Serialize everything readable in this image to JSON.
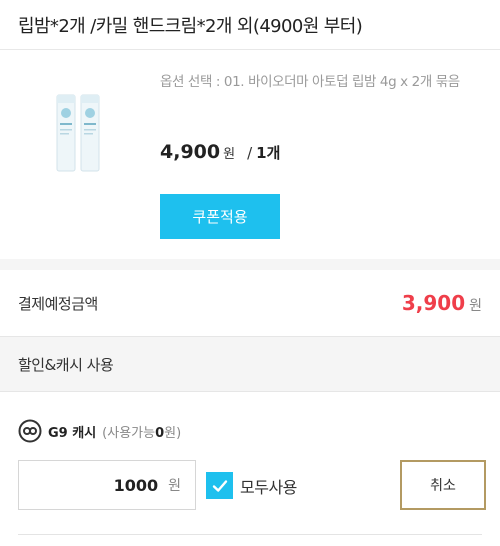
{
  "header": {
    "title": "립밤*2개 /카밀 핸드크림*2개 외(4900원 부터)"
  },
  "product": {
    "option_text": "옵션 선택 : 01. 바이오더마 아토덥 립밤 4g x 2개 묶음",
    "price": "4,900",
    "price_unit": "원",
    "separator": "/",
    "quantity": "1개",
    "coupon_label": "쿠폰적용"
  },
  "total": {
    "label": "결제예정금액",
    "amount": "3,900",
    "unit": "원"
  },
  "discount": {
    "title": "할인&캐시 사용"
  },
  "cash": {
    "name": "G9 캐시",
    "available_prefix": "(사용가능",
    "available_amount": "0",
    "available_suffix": "원)",
    "input_value": "1000",
    "input_unit": "원",
    "use_all_label": "모두사용",
    "use_all_checked": true,
    "cancel_label": "취소"
  },
  "colors": {
    "accent": "#1ec0ee",
    "price_red": "#ef3e4a",
    "cancel_border": "#b39a62"
  }
}
